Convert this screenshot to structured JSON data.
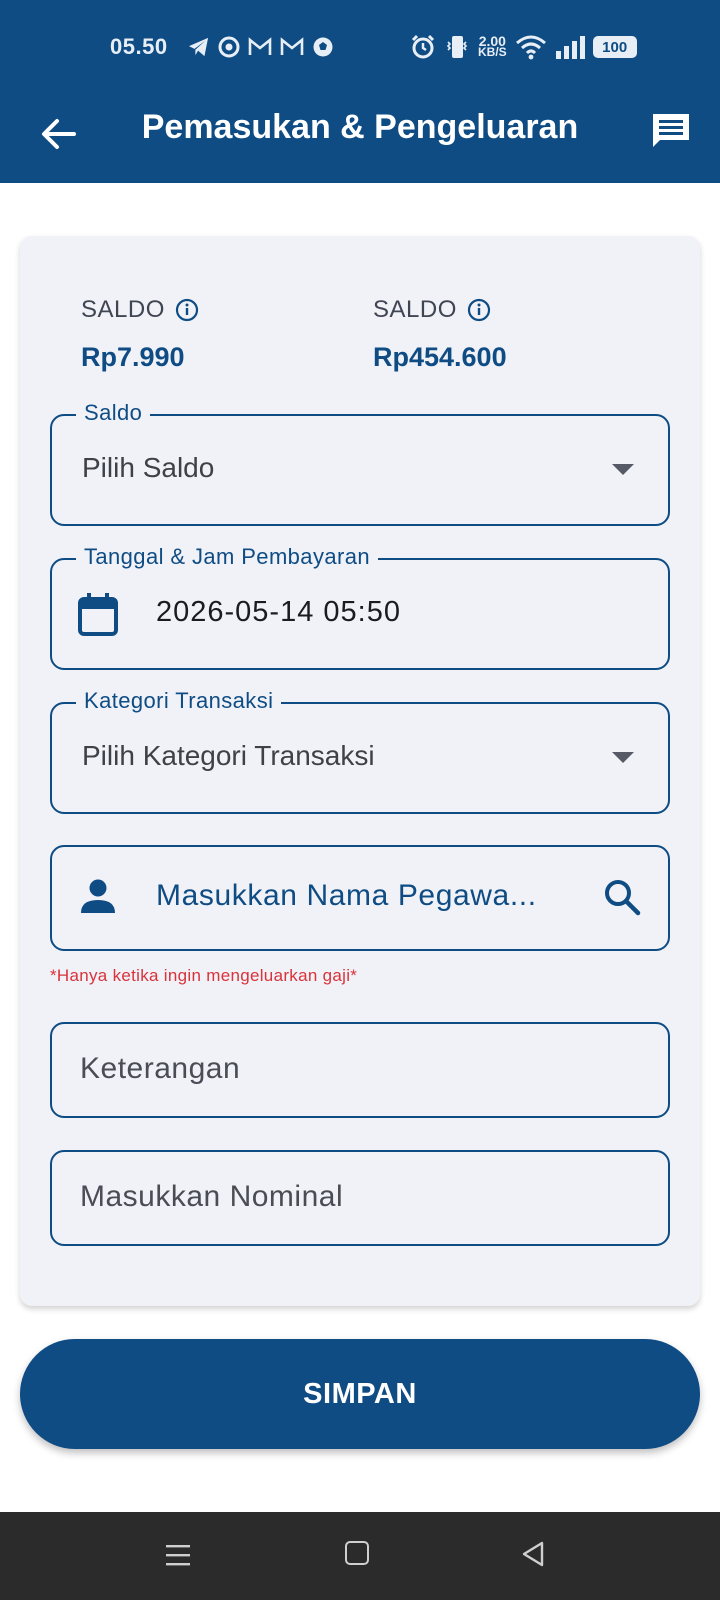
{
  "status_bar": {
    "time": "05.50",
    "speed_value": "2.00",
    "speed_unit": "KB/S",
    "battery": "100"
  },
  "app_bar": {
    "title": "Pemasukan & Pengeluaran"
  },
  "balances": [
    {
      "label": "SALDO",
      "value": "Rp7.990"
    },
    {
      "label": "SALDO",
      "value": "Rp454.600"
    }
  ],
  "form": {
    "saldo": {
      "legend": "Saldo",
      "value": "Pilih Saldo"
    },
    "date": {
      "legend": "Tanggal & Jam Pembayaran",
      "value": "2026-05-14 05:50"
    },
    "kategori": {
      "legend": "Kategori Transaksi",
      "value": "Pilih Kategori Transaksi"
    },
    "pegawai": {
      "placeholder": "Masukkan Nama Pegawa..."
    },
    "pegawai_note": "*Hanya ketika ingin mengeluarkan gaji*",
    "keterangan": {
      "placeholder": "Keterangan"
    },
    "nominal": {
      "placeholder": "Masukkan Nominal"
    }
  },
  "actions": {
    "save_label": "SIMPAN"
  },
  "colors": {
    "primary": "#0f4c84",
    "card_bg": "#f0f2f8",
    "error": "#d9333a"
  }
}
